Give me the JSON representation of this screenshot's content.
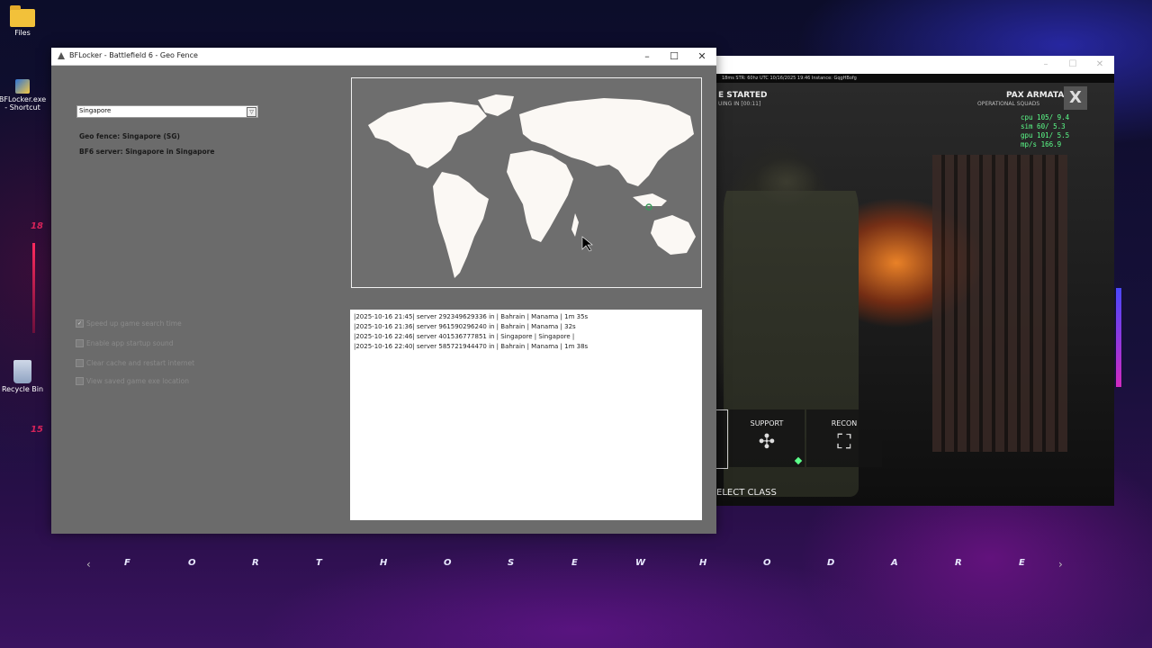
{
  "desktop": {
    "icons": [
      {
        "label": "Files",
        "icon": "folder-icon"
      },
      {
        "label": "BFLocker.exe - Shortcut",
        "icon": "exe-icon"
      },
      {
        "label": "Recycle Bin",
        "icon": "recycle-bin-icon"
      }
    ],
    "neon_numbers": [
      "18",
      "15"
    ],
    "banner_letters": [
      "F",
      "O",
      "R",
      "T",
      "H",
      "O",
      "S",
      "E",
      "W",
      "H",
      "O",
      "D",
      "A",
      "R",
      "E"
    ],
    "banner_prev": "‹",
    "banner_next": "›"
  },
  "app": {
    "title": "BFLocker - Battlefield 6 - Geo Fence",
    "controls": {
      "minimize": "–",
      "maximize": "☐",
      "close": "✕"
    },
    "region_select": {
      "value": "Singapore",
      "button": "▽"
    },
    "geo_fence": "Geo fence: Singapore (SG)",
    "server": "BF6 server: Singapore in Singapore",
    "options": [
      {
        "label": "Speed up game search time",
        "checked": true
      },
      {
        "label": "Enable app startup sound",
        "checked": false
      },
      {
        "label": "Clear cache and restart internet",
        "checked": false
      },
      {
        "label": "View saved game exe location",
        "checked": false
      }
    ],
    "log": [
      "|2025-10-16 21:45| server 292349629336 in | Bahrain | Manama | 1m 35s",
      "|2025-10-16 21:36| server 961590296240 in | Bahrain | Manama | 32s",
      "|2025-10-16 22:46| server 401536777851 in | Singapore | Singapore |",
      "|2025-10-16 22:40| server 585721944470 in | Bahrain | Manama | 1m 38s"
    ]
  },
  "game": {
    "controls": {
      "minimize": "–",
      "maximize": "☐",
      "close": "✕"
    },
    "hud_bar": "18ms   STR: 60hz   UTC 10/16/2025 19:46   Instance: GqgHBofg",
    "match_status": "E STARTED",
    "match_sub": "UING IN [00:11]",
    "faction": "PAX ARMATA",
    "faction_sub": "OPERATIONAL SQUADS",
    "stats": [
      "cpu 105/ 9.4",
      "sim  60/ 5.3",
      "gpu 101/ 5.5",
      "mp/s 166.9"
    ],
    "classes": [
      {
        "label": "SUPPORT",
        "glyph": "✣"
      },
      {
        "label": "RECON",
        "glyph": "⛶"
      }
    ],
    "select_class": "ELECT CLASS"
  },
  "colors": {
    "accent_green": "#5cff8a",
    "app_bg": "#6b6b6b",
    "neon_red": "#d8245a"
  }
}
